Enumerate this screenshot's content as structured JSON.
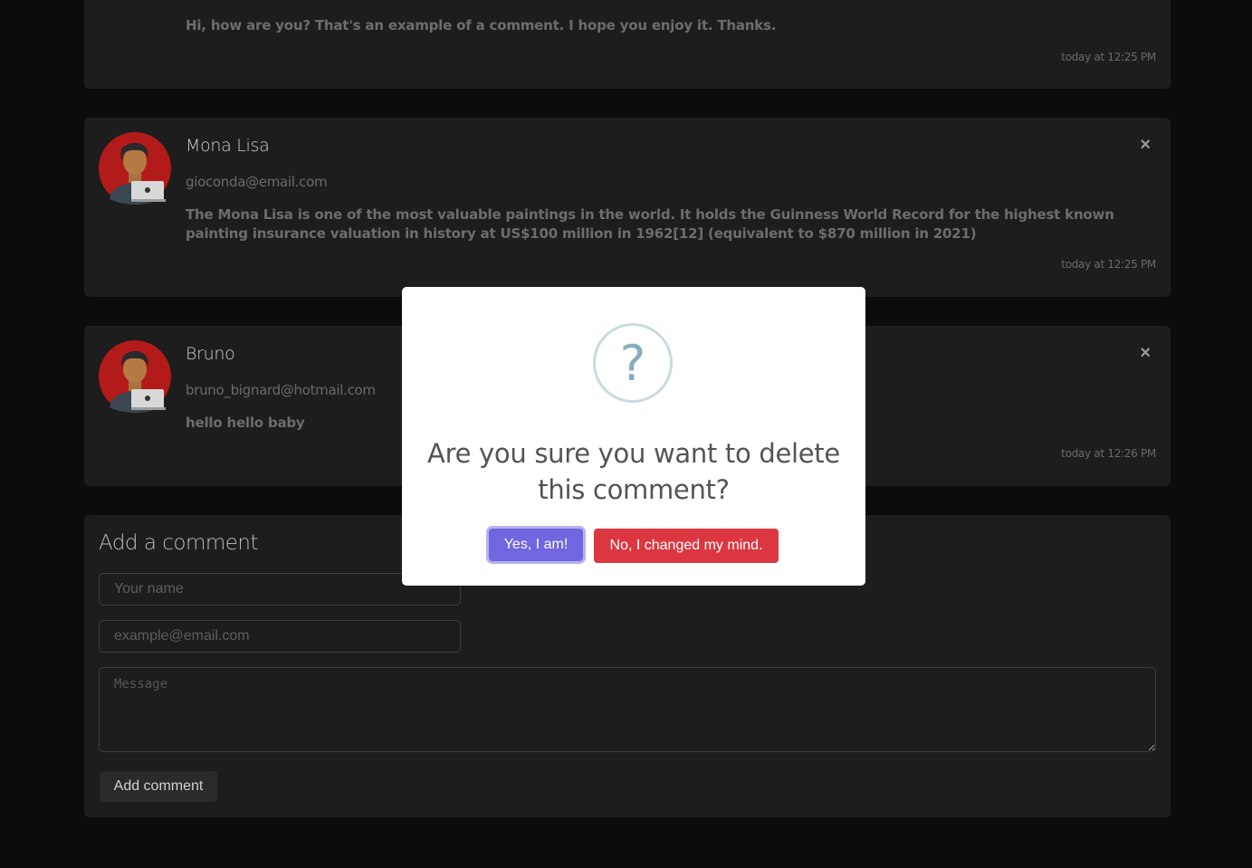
{
  "comments": [
    {
      "name": "",
      "email": "",
      "message": "Hi, how are you? That's an example of a comment. I hope you enjoy it. Thanks.",
      "time": "today at 12:25 PM"
    },
    {
      "name": "Mona Lisa",
      "email": "gioconda@email.com",
      "message": "The Mona Lisa is one of the most valuable paintings in the world. It holds the Guinness World Record for the highest known painting insurance valuation in history at US$100 million in 1962[12] (equivalent to $870 million in 2021)",
      "time": "today at 12:25 PM",
      "close": "×"
    },
    {
      "name": "Bruno",
      "email": "bruno_bignard@hotmail.com",
      "message": "hello hello baby",
      "time": "today at 12:26 PM",
      "close": "×"
    }
  ],
  "form": {
    "title": "Add a comment",
    "name_placeholder": "Your name",
    "email_placeholder": "example@email.com",
    "message_placeholder": "Message",
    "submit_label": "Add comment"
  },
  "dialog": {
    "icon": "?",
    "title": "Are you sure you want to delete this comment?",
    "confirm_label": "Yes, I am!",
    "cancel_label": "No, I changed my mind."
  },
  "colors": {
    "avatar_bg": "#b31b1b",
    "confirm": "#7066e0",
    "cancel": "#dc3741"
  }
}
